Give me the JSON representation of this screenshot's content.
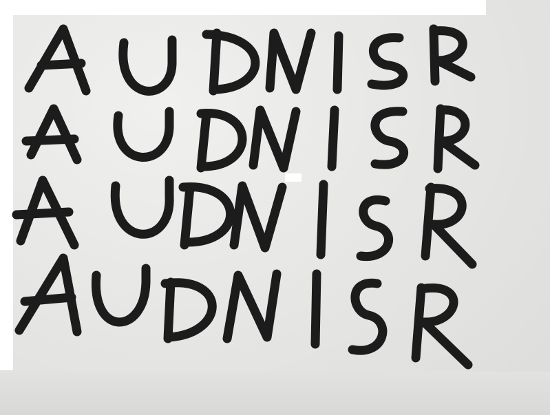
{
  "image": {
    "description_text": "",
    "rows": [
      {
        "letters": [
          "A",
          "U",
          "D",
          "N",
          "I",
          "S",
          "R"
        ]
      },
      {
        "letters": [
          "A",
          "U",
          "D",
          "N",
          "I",
          "S",
          "R"
        ]
      },
      {
        "letters": [
          "A",
          "U",
          "D",
          "N",
          "I",
          "S",
          "R"
        ]
      },
      {
        "letters": [
          "A",
          "U",
          "D",
          "N",
          "I",
          "S",
          "R"
        ]
      }
    ],
    "ink_color": "#1c1c1c",
    "paper_color": "#e7e7e5"
  }
}
